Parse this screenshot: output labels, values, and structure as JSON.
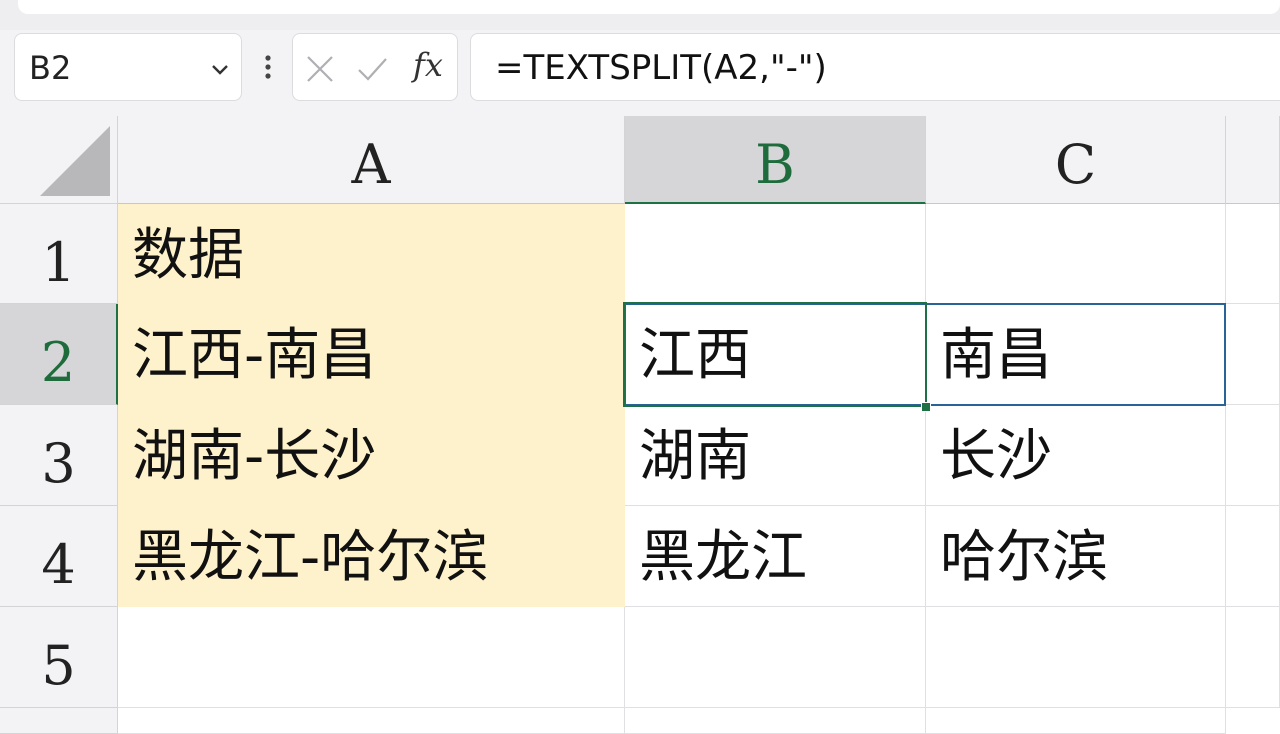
{
  "formula_bar": {
    "name_box": "B2",
    "formula": "=TEXTSPLIT(A2,\"-\")",
    "fx_label": "fx"
  },
  "columns": [
    {
      "label": "A",
      "active": false
    },
    {
      "label": "B",
      "active": true
    },
    {
      "label": "C",
      "active": false
    }
  ],
  "rows": [
    {
      "label": "1",
      "cells": [
        "数据",
        "",
        ""
      ]
    },
    {
      "label": "2",
      "cells": [
        "江西-南昌",
        "江西",
        "南昌"
      ]
    },
    {
      "label": "3",
      "cells": [
        "湖南-长沙",
        "湖南",
        "长沙"
      ]
    },
    {
      "label": "4",
      "cells": [
        "黑龙江-哈尔滨",
        "黑龙江",
        "哈尔滨"
      ]
    },
    {
      "label": "5",
      "cells": [
        "",
        "",
        ""
      ]
    }
  ],
  "selected_cell": "B2",
  "colors": {
    "highlight_fill": "#fef2cc",
    "selection_border": "#1e7145",
    "spill_border": "#2a6496"
  }
}
